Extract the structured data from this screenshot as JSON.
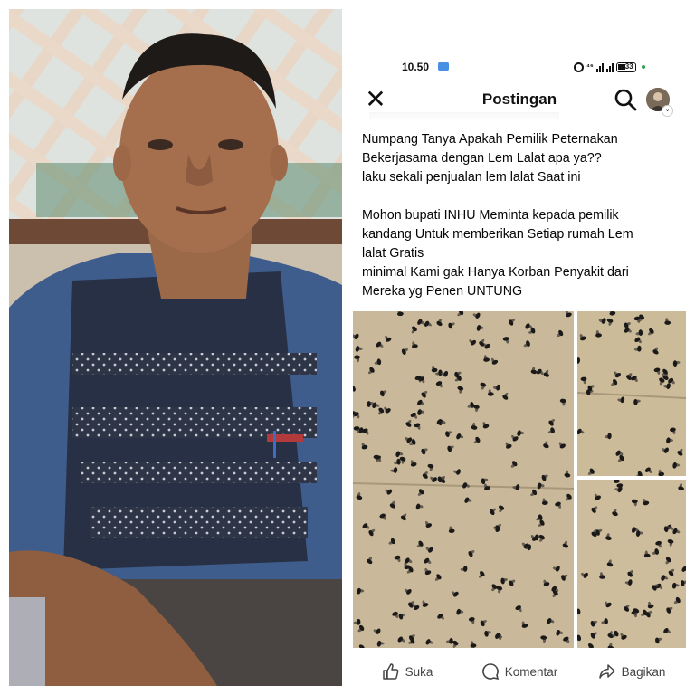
{
  "status_bar": {
    "time": "10.50",
    "network": "⁴⁶",
    "battery": "33"
  },
  "header": {
    "title": "Postingan",
    "close_icon": "close-icon",
    "search_icon": "search-icon"
  },
  "post": {
    "lines": [
      "Numpang Tanya Apakah Pemilik Peternakan",
      "Bekerjasama dengan Lem Lalat apa ya??",
      "laku sekali penjualan lem lalat Saat ini",
      "",
      "Mohon bupati INHU Meminta kepada pemilik",
      "kandang Untuk memberikan Setiap rumah Lem",
      "lalat Gratis",
      "minimal Kami gak Hanya Korban Penyakit dari",
      "Mereka yg Penen UNTUNG"
    ]
  },
  "actions": {
    "like": "Suka",
    "comment": "Komentar",
    "share": "Bagikan"
  },
  "colors": {
    "text": "#050505",
    "muted": "#444444",
    "accent_blue": "#4a90e2",
    "online_green": "#31a24c"
  }
}
